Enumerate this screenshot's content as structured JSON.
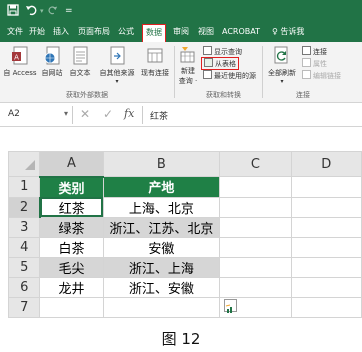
{
  "quick_access": {
    "save_icon": "save-icon",
    "undo_icon": "undo-icon",
    "redo_icon": "redo-icon",
    "customize": "="
  },
  "tabs": [
    {
      "label": "文件"
    },
    {
      "label": "开始"
    },
    {
      "label": "插入"
    },
    {
      "label": "页面布局"
    },
    {
      "label": "公式"
    },
    {
      "label": "数据",
      "active": true
    },
    {
      "label": "审阅"
    },
    {
      "label": "视图"
    },
    {
      "label": "ACROBAT"
    },
    {
      "label": "♀ 告诉我"
    }
  ],
  "ribbon": {
    "get_external": {
      "buttons": [
        {
          "label": "自 Access"
        },
        {
          "label": "自网站"
        },
        {
          "label": "自文本"
        },
        {
          "label": "自其他来源"
        },
        {
          "label": "现有连接"
        }
      ],
      "group_label": "获取外部数据"
    },
    "get_transform": {
      "new_query": {
        "line1": "新建",
        "line2": "查询 ·"
      },
      "show_queries": "显示查询",
      "from_table": "从表格",
      "recent_sources": "最近使用的源",
      "group_label": "获取和转换"
    },
    "connections": {
      "refresh_all": "全部刷新",
      "connections": "连接",
      "properties": "属性",
      "edit_links": "编辑链接",
      "group_label": "连接"
    }
  },
  "formula_bar": {
    "name_box": "A2",
    "cancel": "✕",
    "enter": "✓",
    "fx": "fx",
    "content": "红茶"
  },
  "sheet": {
    "columns": [
      "A",
      "B",
      "C",
      "D"
    ],
    "row_numbers": [
      "1",
      "2",
      "3",
      "4",
      "5",
      "6",
      "7"
    ],
    "header": [
      "类别",
      "产地"
    ],
    "rows": [
      [
        "红茶",
        "上海、北京"
      ],
      [
        "绿茶",
        "浙江、江苏、北京"
      ],
      [
        "白茶",
        "安徽"
      ],
      [
        "毛尖",
        "浙江、上海"
      ],
      [
        "龙井",
        "浙江、安徽"
      ]
    ],
    "selected_cell": "A2"
  },
  "quick_analysis_icon": "quick-analysis-icon",
  "caption": "图 12",
  "colors": {
    "excel_green": "#217346",
    "table_header": "#1f8046",
    "highlight": "#e02020"
  }
}
